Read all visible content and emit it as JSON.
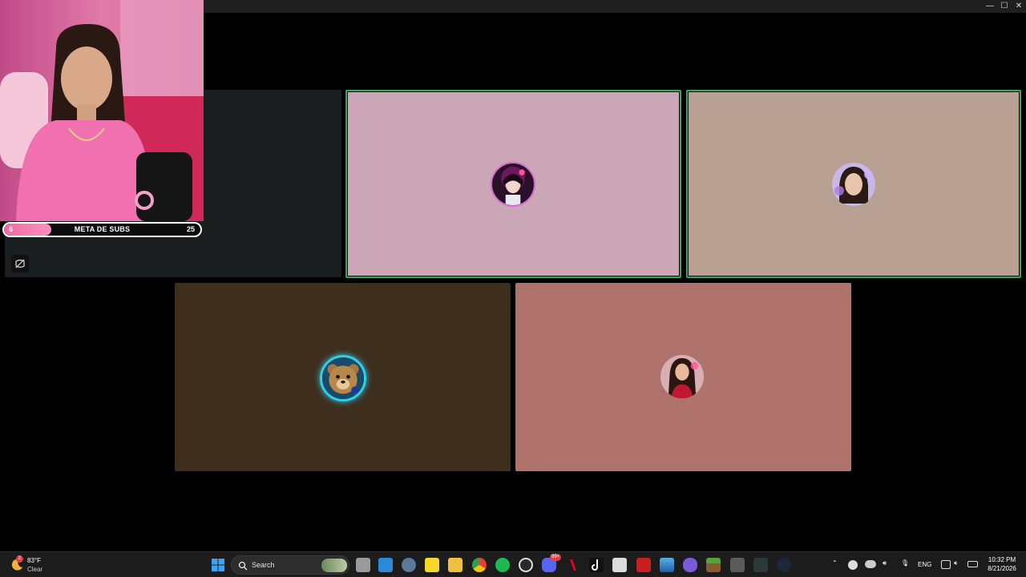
{
  "window": {
    "controls": {
      "minimize": "—",
      "maximize": "☐",
      "close": "✕"
    }
  },
  "call": {
    "tiles": [
      {
        "name": "tile-dark",
        "color": "#1a1e1f",
        "speaking": false,
        "avatar": "none"
      },
      {
        "name": "tile-pink",
        "color": "#caa6b6",
        "speaking": true,
        "avatar": "anime-girl"
      },
      {
        "name": "tile-tan",
        "color": "#b8a092",
        "speaking": true,
        "avatar": "girl-selfie"
      },
      {
        "name": "tile-brown",
        "color": "#3e2e1e",
        "speaking": false,
        "avatar": "teddy-bear"
      },
      {
        "name": "tile-rose",
        "color": "#b0736c",
        "speaking": false,
        "avatar": "woman-red"
      }
    ],
    "speaking_border_color": "#3ba55d"
  },
  "overlay": {
    "goal": {
      "current": "6",
      "label": "META DE SUBS",
      "target": "25",
      "progress": 0.24
    },
    "hidden_video_icon": "video-off-icon"
  },
  "taskbar": {
    "weather": {
      "temp": "83°F",
      "condition": "Clear",
      "badge": "2"
    },
    "search_label": "Search",
    "apps": [
      "windows-start-icon",
      "search-icon",
      "task-view-icon",
      "store-icon",
      "settings-icon",
      "sticky-notes-icon",
      "file-explorer-icon",
      "chrome-icon",
      "spotify-icon",
      "obs-icon",
      "discord-icon",
      "netflix-icon",
      "tiktok-icon",
      "notepad-icon",
      "voicemod-icon",
      "photos-icon",
      "game-controller-icon",
      "minecraft-icon",
      "calculator-icon",
      "terminal-icon",
      "steam-icon"
    ],
    "discord_badge": "99+",
    "tray": {
      "language": "ENG"
    },
    "clock": {
      "time": "10:32 PM",
      "date": "8/21/2026"
    }
  }
}
